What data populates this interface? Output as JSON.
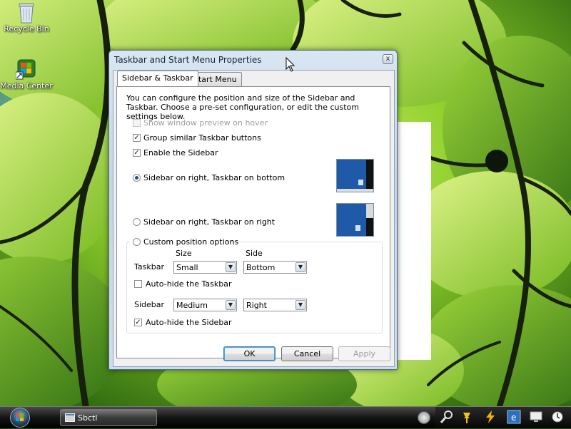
{
  "desktop": {
    "icons": [
      {
        "label": "Recycle Bin",
        "icon": "recycle-bin-icon"
      },
      {
        "label": "Media Center",
        "icon": "media-center-icon"
      }
    ]
  },
  "dialog": {
    "title": "Taskbar and Start Menu Properties",
    "close_label": "x",
    "tabs": [
      {
        "label": "Sidebar & Taskbar",
        "active": true
      },
      {
        "label": "Start Menu",
        "active": false
      }
    ],
    "intro_text": "You can configure the position and size of the Sidebar and Taskbar. Choose a pre-set configuration, or edit the custom settings below.",
    "checkboxes": {
      "show_preview": {
        "label": "Show window preview on hover",
        "checked": false,
        "enabled": false
      },
      "group_buttons": {
        "label": "Group similar Taskbar buttons",
        "checked": true,
        "enabled": true
      },
      "enable_sidebar": {
        "label": "Enable the Sidebar",
        "checked": true,
        "enabled": true
      }
    },
    "check_mark": "✓",
    "radios": {
      "right_bottom": {
        "label": "Sidebar on right, Taskbar on bottom",
        "selected": true
      },
      "right_right": {
        "label": "Sidebar on right, Taskbar on right",
        "selected": false
      },
      "custom": {
        "label": "Custom position options",
        "selected": false
      }
    },
    "custom": {
      "size_header": "Size",
      "side_header": "Side",
      "taskbar_label": "Taskbar",
      "taskbar_size": "Small",
      "taskbar_side": "Bottom",
      "autohide_taskbar": {
        "label": "Auto-hide the Taskbar",
        "checked": false
      },
      "sidebar_label": "Sidebar",
      "sidebar_size": "Medium",
      "sidebar_side": "Right",
      "autohide_sidebar": {
        "label": "Auto-hide the Sidebar",
        "checked": true
      },
      "dropdown_arrow": "▼"
    },
    "buttons": {
      "ok": "OK",
      "cancel": "Cancel",
      "apply": "Apply"
    }
  },
  "taskbar": {
    "task_button_label": "Sbctl",
    "tray_icons": [
      "magnifier-icon",
      "pushpin-icon",
      "lightning-icon",
      "ie-icon",
      "monitor-icon",
      "clock-icon"
    ]
  },
  "colors": {
    "wallpaper_leaf": "#8ed12c",
    "preview_desktop": "#1e5aa8",
    "taskbar": "#141414"
  }
}
